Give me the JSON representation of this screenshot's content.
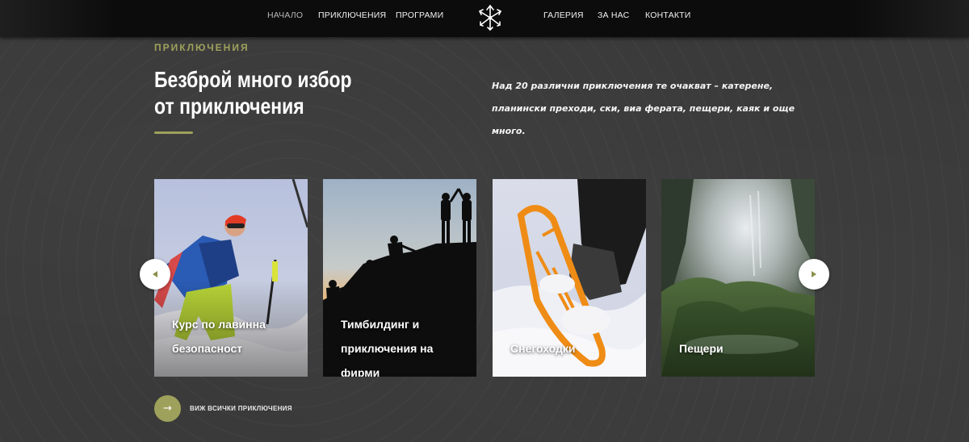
{
  "nav": {
    "left": [
      "НАЧАЛО",
      "ПРИКЛЮЧЕНИЯ",
      "ПРОГРАМИ"
    ],
    "right": [
      "ГАЛЕРИЯ",
      "ЗА НАС",
      "КОНТАКТИ"
    ],
    "active": "НАЧАЛО"
  },
  "section": {
    "eyebrow": "ПРИКЛЮЧЕНИЯ",
    "headline": [
      "Безброй много избор",
      "от приключения"
    ],
    "intro": "Над 20 различни приключения те очакват – катерене, планински преходи, ски, виа ферата, пещери, каяк и още много."
  },
  "cards": [
    {
      "title": "Курс по лавинна безопасност"
    },
    {
      "title": "Тимбилдинг и приключения на фирми"
    },
    {
      "title": "Снегоходки"
    },
    {
      "title": "Пещери"
    }
  ],
  "cta": {
    "icon": "→",
    "label": "ВИЖ ВСИЧКИ ПРИКЛЮЧЕНИЯ"
  },
  "colors": {
    "accent": "#9ea15b",
    "nav_bg": "#0c0c0c",
    "page_bg": "#3a3a3a"
  },
  "icons": [
    "star-logo-icon",
    "arrow-left-icon",
    "arrow-right-icon",
    "arrow-right-icon"
  ]
}
